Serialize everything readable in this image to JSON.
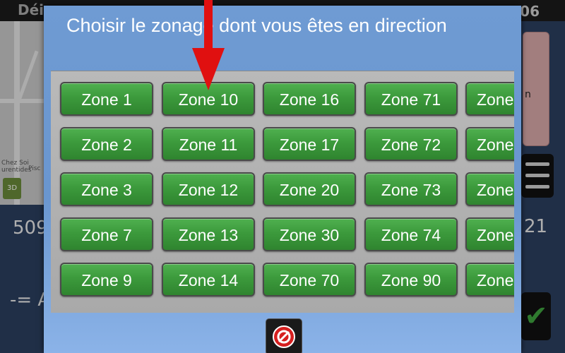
{
  "background": {
    "topbar_left": "Déi",
    "topbar_time": ":06",
    "map_label_1": "Chez Soi",
    "map_label_2": "urentides",
    "map_label_3": "Pisc",
    "badge_3d": "3D",
    "left_text_1": "509",
    "left_text_2": "-= A",
    "right_text": "21",
    "right_card_text": "n"
  },
  "dialog": {
    "title": "Choisir le zonage dont vous êtes en direction"
  },
  "zones": [
    [
      "Zone 1",
      "Zone 10",
      "Zone 16",
      "Zone 71",
      "Zone"
    ],
    [
      "Zone 2",
      "Zone 11",
      "Zone 17",
      "Zone 72",
      "Zone"
    ],
    [
      "Zone 3",
      "Zone 12",
      "Zone 20",
      "Zone 73",
      "Zone"
    ],
    [
      "Zone 7",
      "Zone 13",
      "Zone 30",
      "Zone 74",
      "Zone"
    ],
    [
      "Zone 9",
      "Zone 14",
      "Zone 70",
      "Zone 90",
      "Zone"
    ]
  ],
  "colors": {
    "dialog_blue": "#6f9bd3",
    "zone_green": "#3c9a3c",
    "arrow_red": "#e01010"
  },
  "icons": {
    "cancel": "cancel-circle-icon",
    "arrow": "down-arrow-annotation"
  }
}
